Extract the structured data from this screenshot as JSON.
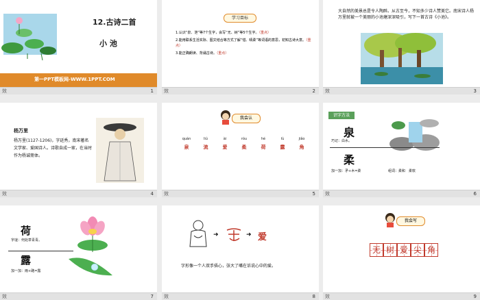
{
  "footer_text": "效",
  "slides": [
    {
      "num": "1",
      "title": "12.古诗二首",
      "subtitle": "小 池",
      "banner": "第一PPT模板网-WWW.1PPT.COM"
    },
    {
      "num": "2",
      "badge": "学习目标",
      "goals": [
        {
          "n": "1.",
          "text": "认识“泉、泄”等7个生字，会写“无、树”等5个生字。",
          "mark": "（重点）"
        },
        {
          "n": "2.",
          "text": "能用联系生活实际、图文结合等方式了解“惜、晴柔”等词语的意思，初知古诗大意。",
          "mark": "（重点）"
        },
        {
          "n": "3.",
          "text": "能正确朗读、背诵古诗。",
          "mark": "（重点）"
        }
      ]
    },
    {
      "num": "3",
      "paragraph": "大自然的美景总是令人陶醉。从古至今，不知多少诗人赞美它。南宋诗人杨万里就被一个美丽的小池塘深深吸引，写下一首古诗《小池》。"
    },
    {
      "num": "4",
      "name": "杨万里",
      "bio": "杨万里(1127-1206)，字廷秀，南宋著名文学家、爱国诗人。诗歌自成一家，在当时作为杨诚斋体。"
    },
    {
      "num": "5",
      "badge": "我会认",
      "chars": [
        {
          "py": "quán",
          "hz": "泉"
        },
        {
          "py": "liú",
          "hz": "流"
        },
        {
          "py": "ài",
          "hz": "爱"
        },
        {
          "py": "róu",
          "hz": "柔"
        },
        {
          "py": "hé",
          "hz": "荷"
        },
        {
          "py": "lù",
          "hz": "露"
        },
        {
          "py": "jiǎo",
          "hz": "角"
        }
      ]
    },
    {
      "num": "6",
      "tag": "识字方法",
      "c1": "泉",
      "c1_tip": "巧记：白水。",
      "c2": "柔",
      "c2_add": "加一加：矛+木=柔",
      "c2_words": "组词：柔和　柔软"
    },
    {
      "num": "7",
      "c1": "荷",
      "c1_tip": "字谜：何处草青青。",
      "c2": "露",
      "c2_add": "加一加：雨+路=露"
    },
    {
      "num": "8",
      "arrow1": "➜",
      "char_evolve": "爱",
      "caption": "字形像一个人双手捂心，张大了嘴在诉说心中的爱。"
    },
    {
      "num": "9",
      "badge": "我会写",
      "write_chars": [
        "无",
        "树",
        "爱",
        "尖",
        "角"
      ]
    }
  ],
  "colors": {
    "accent_red": "#c0392b",
    "banner_orange": "#e08a2a",
    "pond_green": "#5aa05a"
  }
}
